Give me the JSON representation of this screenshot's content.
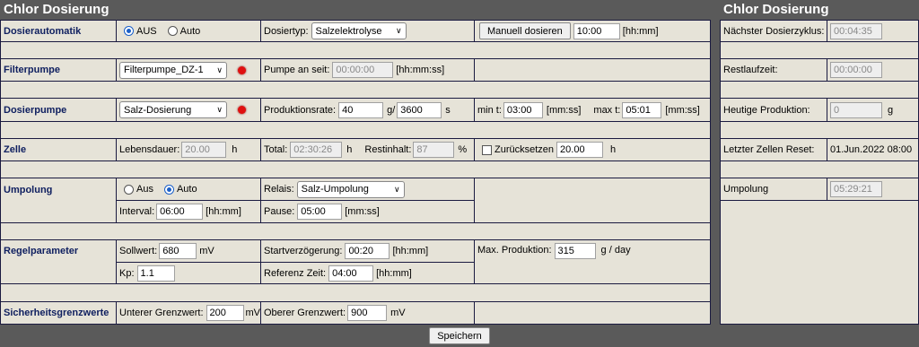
{
  "left_title": "Chlor Dosierung",
  "right_title": "Chlor Dosierung",
  "rows": {
    "dosierautomatik": {
      "label": "Dosierautomatik",
      "opt_aus": "AUS",
      "opt_auto": "Auto",
      "dosiertyp_label": "Dosiertyp:",
      "dosiertyp_value": "Salzelektrolyse",
      "manuell_button": "Manuell dosieren",
      "manuell_time": "10:00",
      "manuell_unit": "[hh:mm]"
    },
    "filterpumpe": {
      "label": "Filterpumpe",
      "pump_select": "Filterpumpe_DZ-1",
      "pumpe_an_label": "Pumpe an seit:",
      "pumpe_an_value": "00:00:00",
      "pumpe_an_unit": "[hh:mm:ss]"
    },
    "dosierpumpe": {
      "label": "Dosierpumpe",
      "pump_select": "Salz-Dosierung",
      "rate_label": "Produktionsrate:",
      "rate_value": "40",
      "rate_sep": "g/",
      "rate_time": "3600",
      "rate_unit": "s",
      "min_label": "min t:",
      "min_value": "03:00",
      "min_unit": "[mm:ss]",
      "max_label": "max t:",
      "max_value": "05:01",
      "max_unit": "[mm:ss]"
    },
    "zelle": {
      "label": "Zelle",
      "lebensdauer_label": "Lebensdauer:",
      "lebensdauer_value": "20.00",
      "lebensdauer_unit": "h",
      "total_label": "Total:",
      "total_value": "02:30:26",
      "total_unit": "h",
      "restinhalt_label": "Restinhalt:",
      "restinhalt_value": "87",
      "restinhalt_unit": "%",
      "reset_label": "Zurücksetzen",
      "reset_value": "20.00",
      "reset_unit": "h"
    },
    "umpolung": {
      "label": "Umpolung",
      "opt_aus": "Aus",
      "opt_auto": "Auto",
      "relais_label": "Relais:",
      "relais_value": "Salz-Umpolung",
      "interval_label": "Interval:",
      "interval_value": "06:00",
      "interval_unit": "[hh:mm]",
      "pause_label": "Pause:",
      "pause_value": "05:00",
      "pause_unit": "[mm:ss]"
    },
    "regelparameter": {
      "label": "Regelparameter",
      "sollwert_label": "Sollwert:",
      "sollwert_value": "680",
      "sollwert_unit": "mV",
      "start_label": "Startverzögerung:",
      "start_value": "00:20",
      "start_unit": "[hh:mm]",
      "maxprod_label": "Max. Produktion:",
      "maxprod_value": "315",
      "maxprod_unit": "g / day",
      "kp_label": "Kp:",
      "kp_value": "1.1",
      "ref_label": "Referenz Zeit:",
      "ref_value": "04:00",
      "ref_unit": "[hh:mm]"
    },
    "sicherheit": {
      "label": "Sicherheitsgrenzwerte",
      "unterer_label": "Unterer Grenzwert:",
      "unterer_value": "200",
      "unterer_unit": "mV",
      "oberer_label": "Oberer Grenzwert:",
      "oberer_value": "900",
      "oberer_unit": "mV"
    }
  },
  "right": {
    "naechster_label": "Nächster Dosierzyklus:",
    "naechster_value": "00:04:35",
    "restlauf_label": "Restlaufzeit:",
    "restlauf_value": "00:00:00",
    "heutige_label": "Heutige Produktion:",
    "heutige_value": "0",
    "heutige_unit": "g",
    "reset_label": "Letzter Zellen Reset:",
    "reset_value": "01.Jun.2022 08:00",
    "umpolung_label": "Umpolung",
    "umpolung_value": "05:29:21"
  },
  "save_button": "Speichern",
  "colors": {
    "background": "#5a5a5a",
    "cell": "#e6e3d8",
    "border": "#1a1a40",
    "label": "#102060",
    "led": "#e01010"
  }
}
